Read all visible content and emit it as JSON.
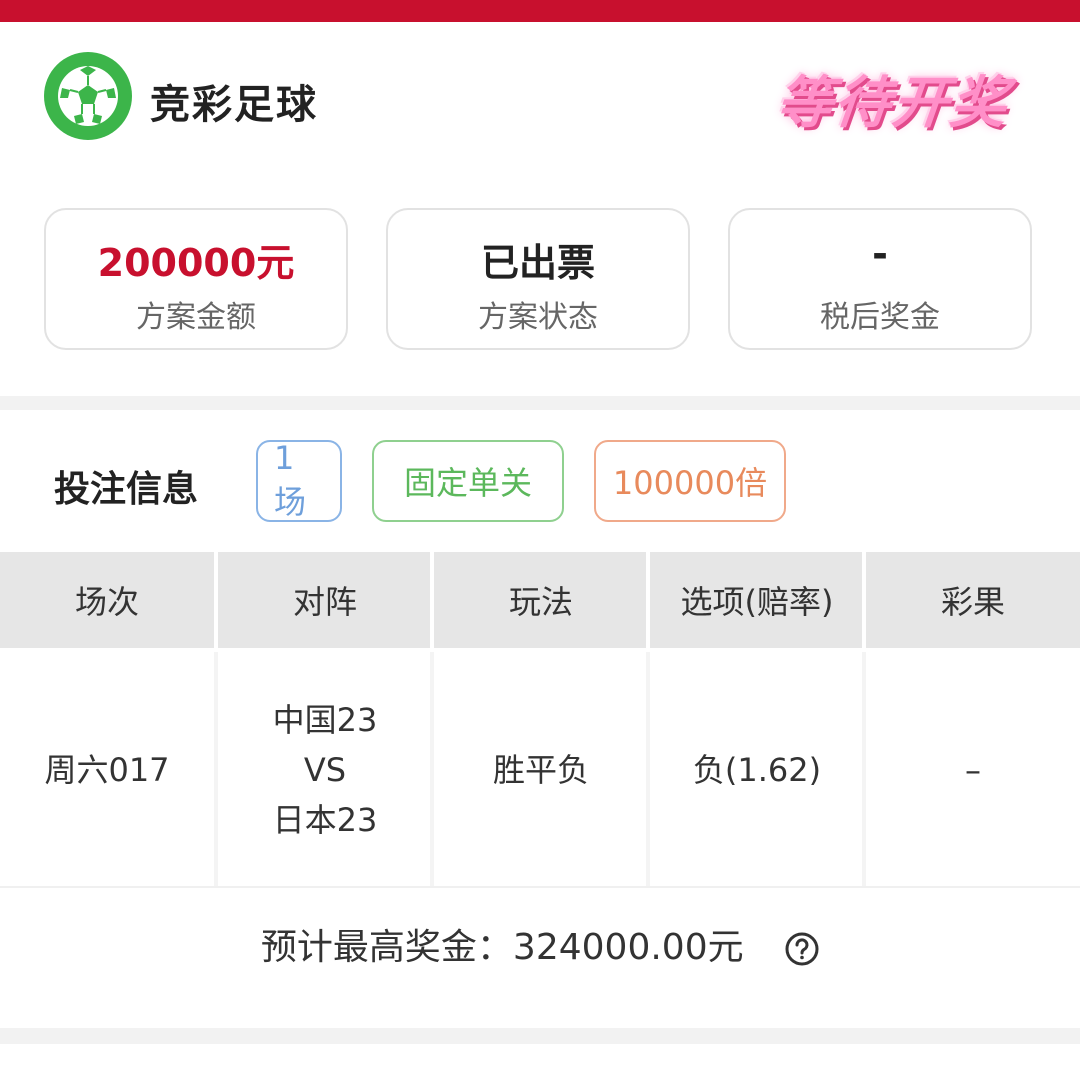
{
  "header": {
    "app_title": "竞彩足球",
    "status_banner": "等待开奖",
    "logo_icon": "soccer-ball-icon",
    "brand_color": "#c8102e"
  },
  "summary": {
    "amount": {
      "value": "200000元",
      "label": "方案金额"
    },
    "status": {
      "value": "已出票",
      "label": "方案状态"
    },
    "prize": {
      "value": "-",
      "label": "税后奖金"
    }
  },
  "bet_info": {
    "title": "投注信息",
    "tags": [
      "1场",
      "固定单关",
      "100000倍"
    ]
  },
  "table": {
    "headers": [
      "场次",
      "对阵",
      "玩法",
      "选项(赔率)",
      "彩果"
    ],
    "row": {
      "match_no": "周六017",
      "home": "中国23",
      "vs": "VS",
      "away": "日本23",
      "play": "胜平负",
      "option": "负(1.62)",
      "result": "–"
    }
  },
  "footer": {
    "max_prize": "预计最高奖金：324000.00元",
    "help_icon": "question-circle-icon"
  }
}
